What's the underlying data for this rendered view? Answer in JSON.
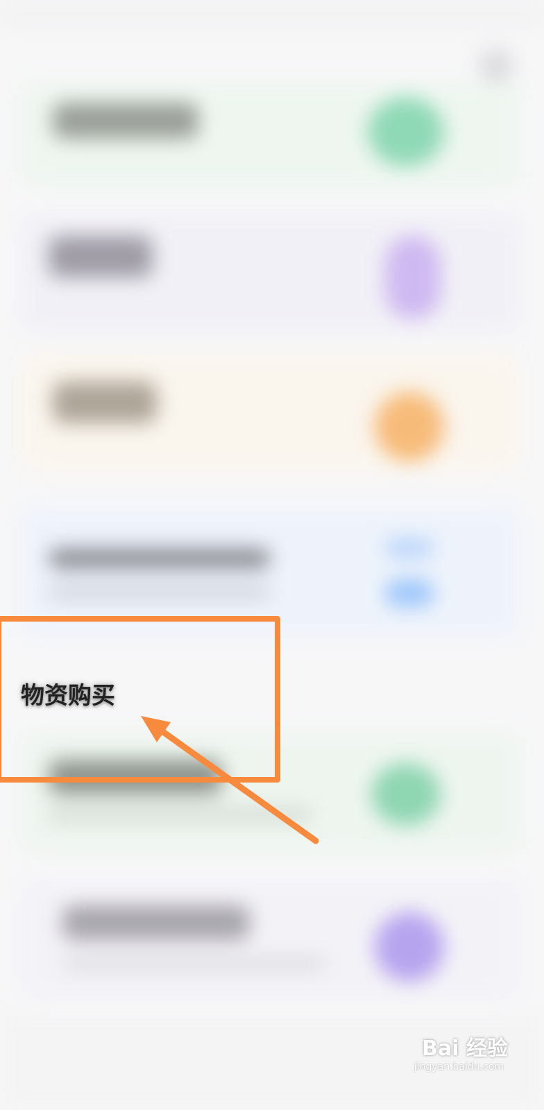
{
  "section": {
    "title": "物资购买"
  },
  "watermark": {
    "brand": "Bai 经验",
    "url": "jingyan.baidu.com"
  },
  "colors": {
    "highlight": "#f88a3e"
  }
}
